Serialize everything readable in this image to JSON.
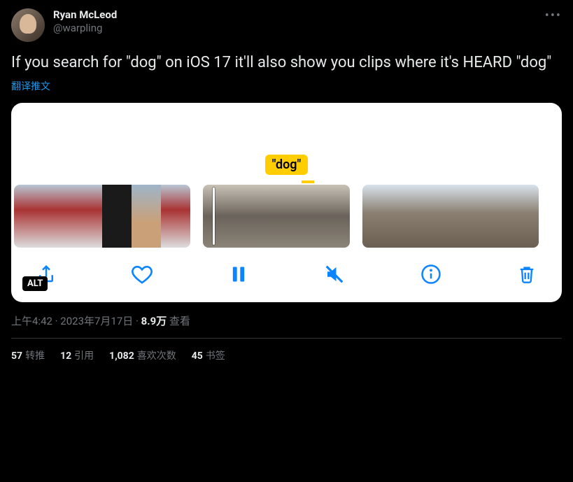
{
  "tweet": {
    "display_name": "Ryan McLeod",
    "handle": "@warpling",
    "text": "If you search for \"dog\" on iOS 17 it'll also show you clips where it's HEARD \"dog\"",
    "translate_label": "翻译推文",
    "timestamp": "上午4:42 · 2023年7月17日",
    "views_count": "8.9万",
    "views_label": " 查看",
    "dot": " · "
  },
  "media": {
    "dog_label": "\"dog\"",
    "alt_badge": "ALT"
  },
  "stats": {
    "retweets_count": "57",
    "retweets_label": "转推",
    "quotes_count": "12",
    "quotes_label": "引用",
    "likes_count": "1,082",
    "likes_label": "喜欢次数",
    "bookmarks_count": "45",
    "bookmarks_label": "书签"
  }
}
